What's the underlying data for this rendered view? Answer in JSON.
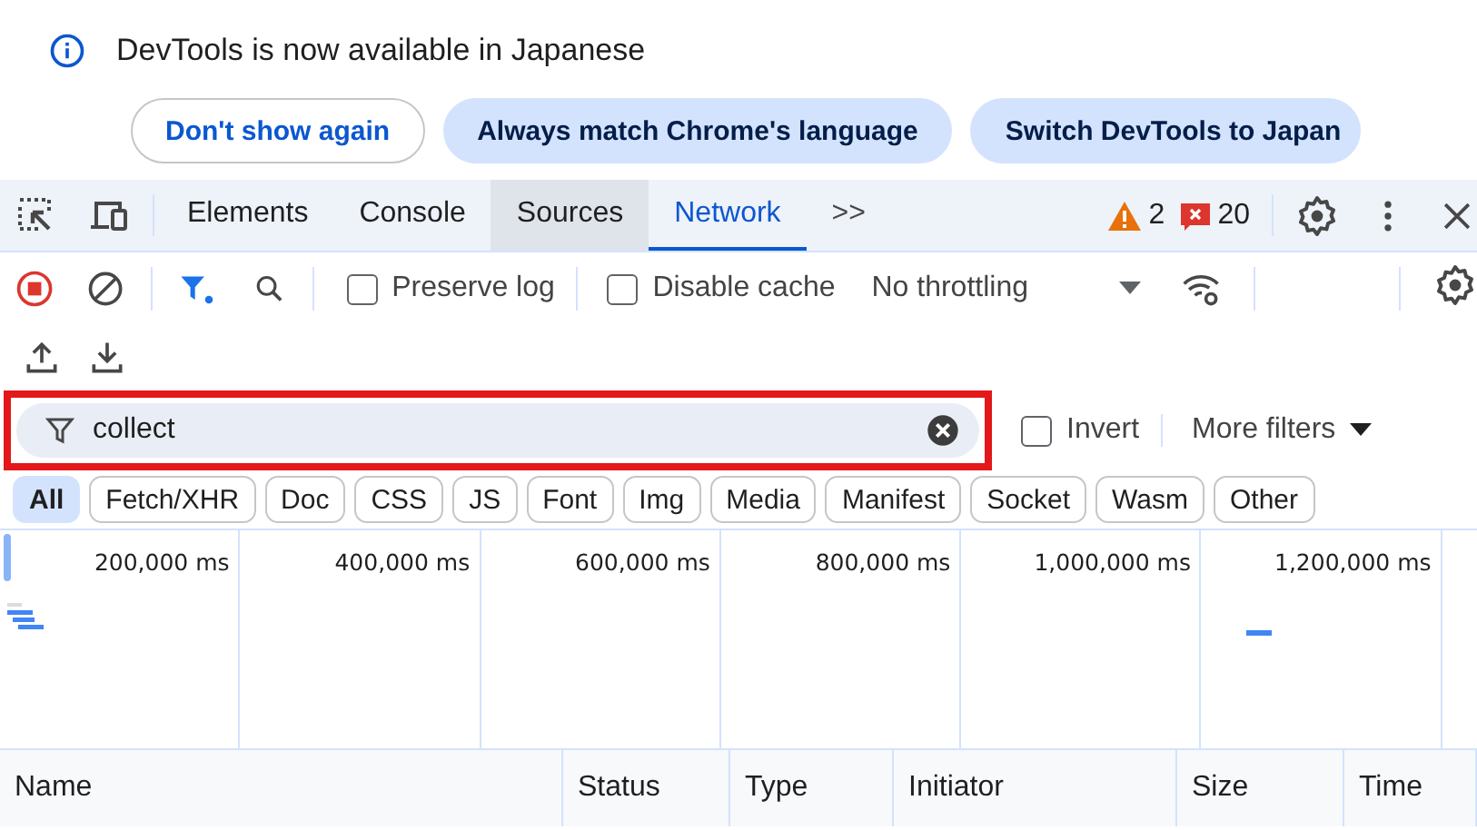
{
  "infobar": {
    "message": "DevTools is now available in Japanese",
    "buttons": [
      {
        "label": "Don't show again",
        "kind": "outline"
      },
      {
        "label": "Always match Chrome's language",
        "kind": "filled"
      },
      {
        "label": "Switch DevTools to Japan",
        "kind": "filled"
      }
    ]
  },
  "tabs": [
    {
      "label": "Elements",
      "selected": false,
      "hovered": false
    },
    {
      "label": "Console",
      "selected": false,
      "hovered": false
    },
    {
      "label": "Sources",
      "selected": false,
      "hovered": true
    },
    {
      "label": "Network",
      "selected": true,
      "hovered": false
    }
  ],
  "overflow_tabs": ">>",
  "warnings": "2",
  "errors": "20",
  "toolbar": {
    "recording": true,
    "filter_active": true,
    "preserve_log": {
      "label": "Preserve log",
      "checked": false
    },
    "disable_cache": {
      "label": "Disable cache",
      "checked": false
    },
    "throttling": "No throttling"
  },
  "filter": {
    "value": "collect",
    "highlighted": true,
    "invert": {
      "label": "Invert",
      "checked": false
    },
    "more_filters": "More filters"
  },
  "types": [
    {
      "label": "All",
      "selected": true
    },
    {
      "label": "Fetch/XHR",
      "selected": false
    },
    {
      "label": "Doc",
      "selected": false
    },
    {
      "label": "CSS",
      "selected": false
    },
    {
      "label": "JS",
      "selected": false
    },
    {
      "label": "Font",
      "selected": false
    },
    {
      "label": "Img",
      "selected": false
    },
    {
      "label": "Media",
      "selected": false
    },
    {
      "label": "Manifest",
      "selected": false
    },
    {
      "label": "Socket",
      "selected": false
    },
    {
      "label": "Wasm",
      "selected": false
    },
    {
      "label": "Other",
      "selected": false
    }
  ],
  "timeline": {
    "ticks": [
      "200,000 ms",
      "400,000 ms",
      "600,000 ms",
      "800,000 ms",
      "1,000,000 ms",
      "1,200,000 ms"
    ]
  },
  "table": {
    "columns": [
      "Name",
      "Status",
      "Type",
      "Initiator",
      "Size",
      "Time"
    ]
  }
}
